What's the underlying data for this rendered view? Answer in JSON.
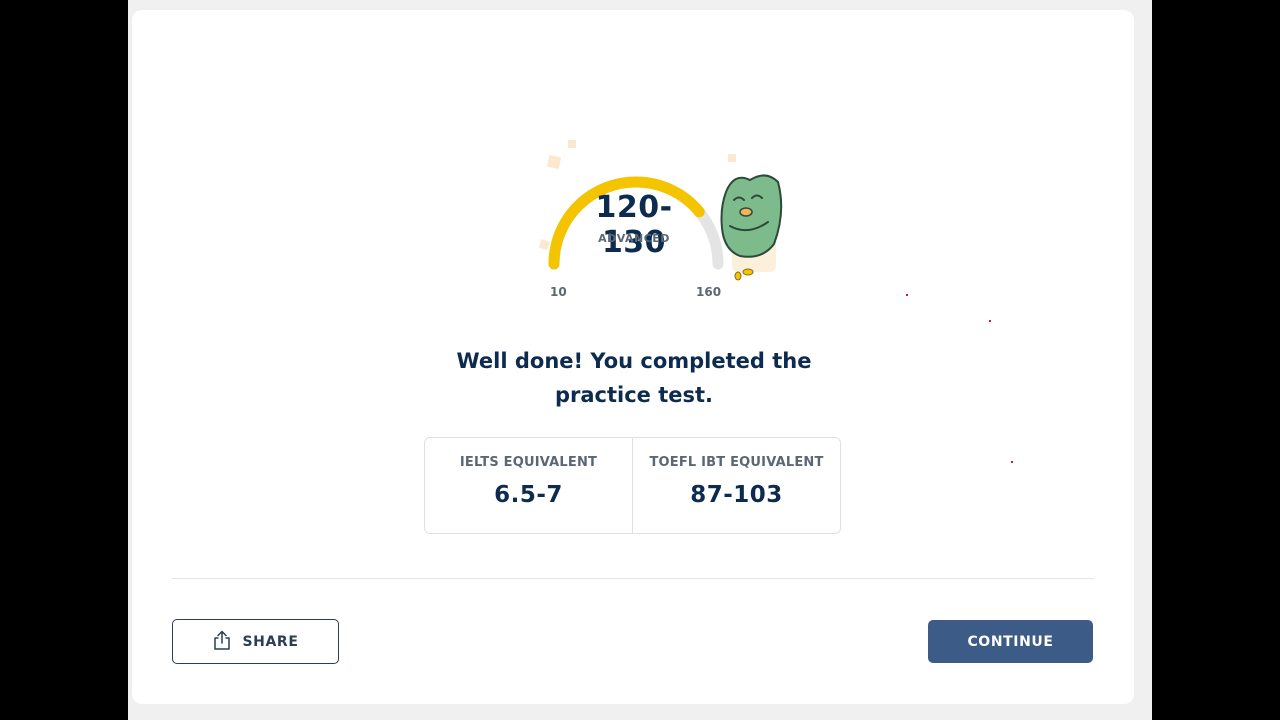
{
  "score": {
    "range": "120-130",
    "level": "ADVANCED",
    "scale_min": "10",
    "scale_max": "160",
    "progress_fraction": 0.78,
    "progress_color": "#f5c400",
    "track_color": "#e4e4e4"
  },
  "message": {
    "headline": "Well done! You completed the practice test."
  },
  "equivalents": [
    {
      "label": "IELTS EQUIVALENT",
      "value": "6.5-7"
    },
    {
      "label": "TOEFL IBT EQUIVALENT",
      "value": "87-103"
    }
  ],
  "actions": {
    "share_label": "SHARE",
    "share_icon": "share-icon",
    "continue_label": "CONTINUE"
  },
  "colors": {
    "primary_text": "#0d2b4e",
    "button_primary": "#3d5b87",
    "mascot": "#7dbb8c"
  }
}
